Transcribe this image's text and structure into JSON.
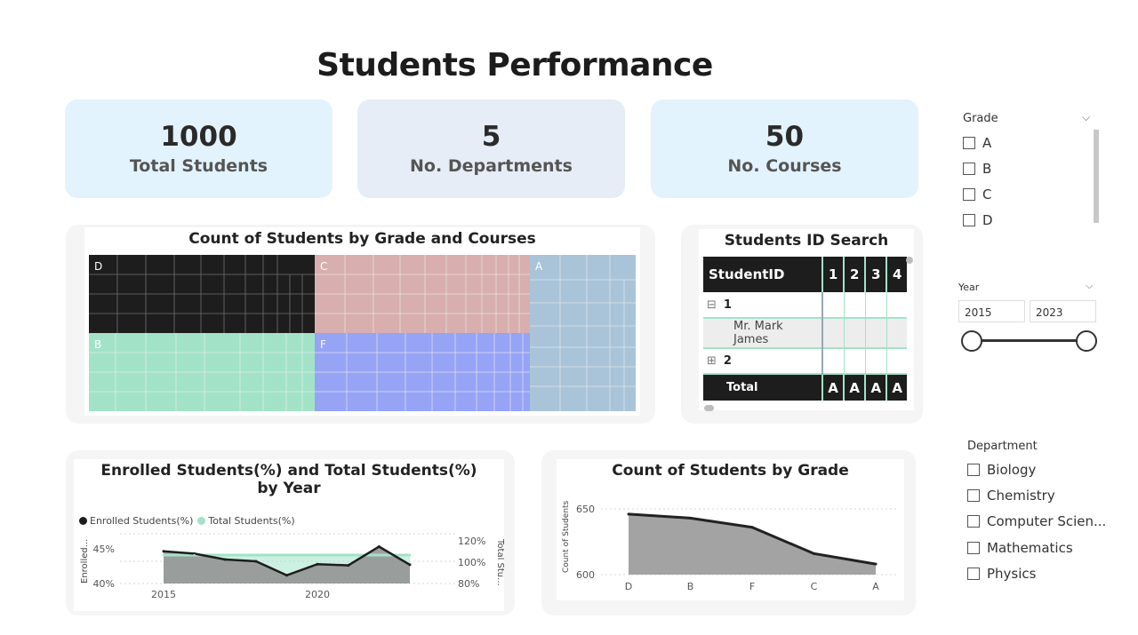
{
  "page_title": "Students Performance",
  "kpis": [
    {
      "value": "1000",
      "label": "Total Students",
      "color": "#e3f3fd"
    },
    {
      "value": "5",
      "label": "No. Departments",
      "color": "#e6edf7"
    },
    {
      "value": "50",
      "label": "No. Courses",
      "color": "#e3f3fd"
    }
  ],
  "treemap": {
    "title": "Count of Students by Grade and Courses",
    "cells": [
      {
        "label": "D",
        "color": "#1d1d1d"
      },
      {
        "label": "C",
        "color": "#d8aeae"
      },
      {
        "label": "A",
        "color": "#a9c4d9"
      },
      {
        "label": "B",
        "color": "#a2e3c8"
      },
      {
        "label": "F",
        "color": "#97a3f5"
      }
    ]
  },
  "student_table": {
    "title": "Students ID Search",
    "header": {
      "id": "StudentID",
      "cols": [
        "1",
        "2",
        "3",
        "4"
      ]
    },
    "rows": [
      {
        "expander": "⊟",
        "label": "1"
      },
      {
        "label": "Mr. Mark James"
      },
      {
        "expander": "⊞",
        "label": "2"
      }
    ],
    "total_label": "Total",
    "total_values": [
      "A",
      "A",
      "A",
      "A"
    ]
  },
  "enroll_chart": {
    "title_line1": "Enrolled Students(%) and Total Students(%)",
    "title_line2": "by Year",
    "legend": [
      "Enrolled Students(%)",
      "Total Students(%)"
    ],
    "left_axis_label": "Enrolled...",
    "right_axis_label": "Total Stu...",
    "left_ticks": [
      "45%",
      "40%"
    ],
    "right_ticks": [
      "120%",
      "100%",
      "80%"
    ],
    "x_ticks": [
      "2015",
      "2020"
    ]
  },
  "grade_chart": {
    "title": "Count of Students by Grade",
    "y_axis_label": "Count of Students",
    "y_ticks": [
      "650",
      "600"
    ]
  },
  "chart_data": [
    {
      "type": "line",
      "title": "Enrolled Students(%) and Total Students(%) by Year",
      "x": [
        2015,
        2016,
        2017,
        2018,
        2019,
        2020,
        2021,
        2022,
        2023
      ],
      "series": [
        {
          "name": "Enrolled Students(%)",
          "axis": "left",
          "values": [
            44.5,
            44.1,
            43.1,
            42.8,
            40.4,
            42.3,
            42.1,
            45.3,
            42.2
          ]
        },
        {
          "name": "Total Students(%)",
          "axis": "right",
          "values": [
            100,
            100,
            100,
            100,
            100,
            100,
            100,
            100,
            100
          ]
        }
      ],
      "ylim_left": [
        39,
        47.5
      ],
      "ylim_right": [
        80,
        120
      ],
      "xlabel": "",
      "ylabel": "Enrolled...",
      "ylabel_right": "Total Stu...",
      "legend": "top-left",
      "colors": {
        "enrolled_line": "#1d1d1d",
        "enrolled_fill": "#8f8f8f",
        "total_line": "#a2e3c8",
        "total_fill": "#a2e3c8"
      }
    },
    {
      "type": "area",
      "title": "Count of Students by Grade",
      "categories": [
        "D",
        "B",
        "F",
        "C",
        "A"
      ],
      "values": [
        646,
        643,
        636,
        616,
        608
      ],
      "ylim": [
        600,
        650
      ],
      "xlabel": "",
      "ylabel": "Count of Students",
      "colors": {
        "fill": "#a3a3a3",
        "line": "#222222"
      }
    }
  ],
  "slicers": {
    "grade": {
      "title": "Grade",
      "options": [
        "A",
        "B",
        "C",
        "D"
      ]
    },
    "year": {
      "title": "Year",
      "from": "2015",
      "to": "2023"
    },
    "department": {
      "title": "Department",
      "options": [
        "Biology",
        "Chemistry",
        "Computer Scien...",
        "Mathematics",
        "Physics"
      ]
    }
  }
}
